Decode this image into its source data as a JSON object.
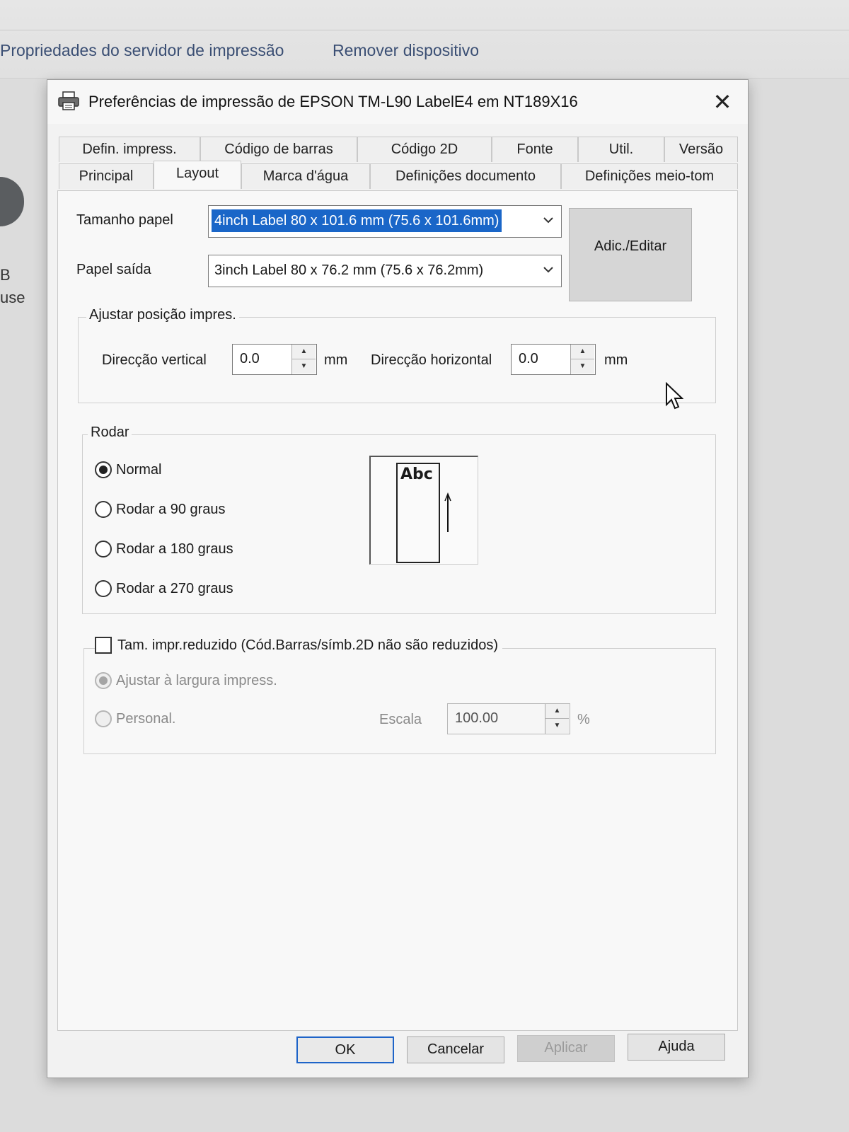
{
  "background": {
    "links": [
      "Propriedades do servidor de impressão",
      "Remover dispositivo"
    ],
    "side_text": [
      "B",
      "use"
    ]
  },
  "dialog": {
    "title": "Preferências de impressão de EPSON TM-L90 LabelE4 em NT189X16",
    "close_symbol": "✕",
    "tabs_row1": [
      "Defin. impress.",
      "Código de barras",
      "Código 2D",
      "Fonte",
      "Util.",
      "Versão"
    ],
    "tabs_row2": [
      "Principal",
      "Layout",
      "Marca d'água",
      "Definições documento",
      "Definições meio-tom"
    ],
    "active_tab": "Layout"
  },
  "layout": {
    "paper_size_label": "Tamanho papel",
    "paper_size_value": "4inch Label 80 x 101.6 mm (75.6 x 101.6mm)",
    "output_paper_label": "Papel saída",
    "output_paper_value": "3inch Label 80 x 76.2 mm (75.6 x 76.2mm)",
    "add_edit_button": "Adic./Editar",
    "adjust_group": {
      "title": "Ajustar posição impres.",
      "vertical_label": "Direcção vertical",
      "vertical_value": "0.0",
      "horizontal_label": "Direcção horizontal",
      "horizontal_value": "0.0",
      "unit": "mm"
    },
    "rotate_group": {
      "title": "Rodar",
      "options": [
        "Normal",
        "Rodar a 90 graus",
        "Rodar a 180 graus",
        "Rodar a 270 graus"
      ],
      "selected": "Normal",
      "preview_text": "Abc"
    },
    "reduce_group": {
      "checkbox_label": "Tam. impr.reduzido (Cód.Barras/símb.2D não são reduzidos)",
      "checked": false,
      "fit_label": "Ajustar à largura impress.",
      "custom_label": "Personal.",
      "scale_label": "Escala",
      "scale_value": "100.00",
      "scale_unit": "%"
    }
  },
  "footer": {
    "ok": "OK",
    "cancel": "Cancelar",
    "apply": "Aplicar",
    "help": "Ajuda"
  },
  "colors": {
    "selection": "#1a66c8",
    "default_button_border": "#1e64c8"
  }
}
